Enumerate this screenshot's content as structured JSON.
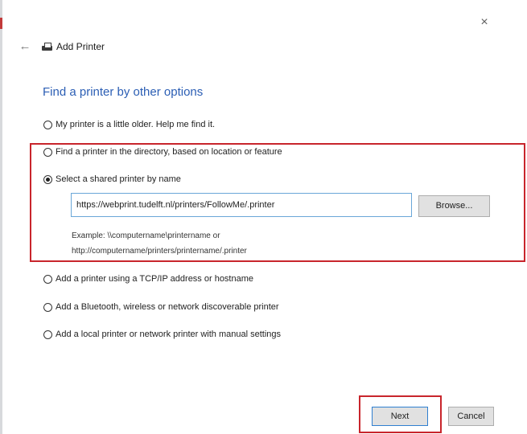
{
  "window": {
    "title": "Add Printer",
    "close_glyph": "×",
    "back_glyph": "←"
  },
  "heading": "Find a printer by other options",
  "options": [
    {
      "label": "My printer is a little older. Help me find it.",
      "checked": false
    },
    {
      "label": "Find a printer in the directory, based on location or feature",
      "checked": false
    },
    {
      "label": "Select a shared printer by name",
      "checked": true
    },
    {
      "label": "Add a printer using a TCP/IP address or hostname",
      "checked": false
    },
    {
      "label": "Add a Bluetooth, wireless or network discoverable printer",
      "checked": false
    },
    {
      "label": "Add a local printer or network printer with manual settings",
      "checked": false
    }
  ],
  "shared_printer": {
    "value": "https://webprint.tudelft.nl/printers/FollowMe/.printer",
    "browse_label": "Browse...",
    "example_line1": "Example: \\\\computername\\printername or",
    "example_line2": "http://computername/printers/printername/.printer"
  },
  "buttons": {
    "next": "Next",
    "cancel": "Cancel"
  },
  "colors": {
    "heading": "#2b5eb4",
    "highlight": "#c8252c",
    "input_border": "#6aa7d8"
  }
}
